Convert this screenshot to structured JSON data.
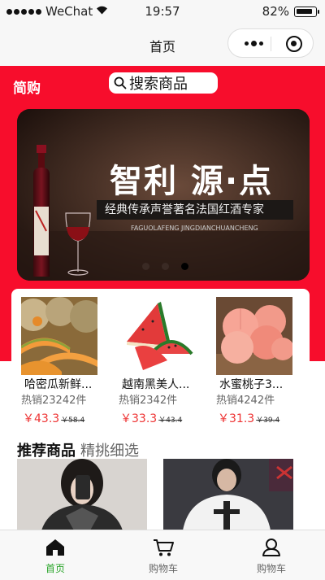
{
  "status_bar": {
    "carrier": "WeChat",
    "time": "19:57",
    "battery": "82%"
  },
  "nav": {
    "title": "首页"
  },
  "header": {
    "brand": "简购",
    "search_label": "搜索商品"
  },
  "banner": {
    "title": "智利 源·点",
    "subtitle": "经典传承声誉著名法国红酒专家",
    "english": "FAGUOLAFENG JINGDIANCHUANCHENG",
    "slide_count": 3,
    "active_slide": 3
  },
  "products": [
    {
      "name": "哈密瓜新鲜...",
      "sold": "热销23242件",
      "price": "￥43.3",
      "old_price": "￥58.4"
    },
    {
      "name": "越南黑美人...",
      "sold": "热销2342件",
      "price": "￥33.3",
      "old_price": "￥43.4"
    },
    {
      "name": "水蜜桃子3...",
      "sold": "热销4242件",
      "price": "￥31.3",
      "old_price": "￥39.4"
    }
  ],
  "recommend": {
    "title": "推荐商品",
    "subtitle": "精挑细选"
  },
  "tabbar": [
    {
      "label": "首页",
      "icon": "home-icon",
      "active": true
    },
    {
      "label": "购物车",
      "icon": "cart-icon",
      "active": false
    },
    {
      "label": "购物车",
      "icon": "user-icon",
      "active": false
    }
  ],
  "colors": {
    "header_red": "#f70d2c",
    "price_red": "#e33333",
    "tab_active": "#2aa52a"
  }
}
